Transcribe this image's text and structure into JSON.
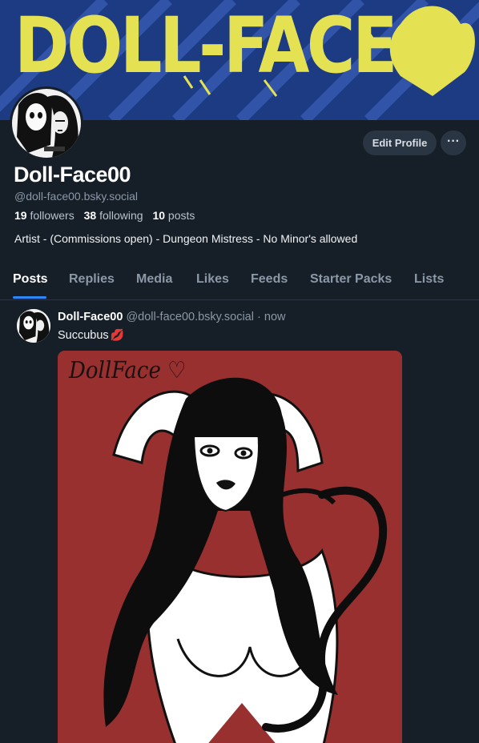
{
  "banner": {
    "text": "DOLL-FACE"
  },
  "profile": {
    "display_name": "Doll-Face00",
    "handle": "@doll-face00.bsky.social",
    "followers_count": "19",
    "followers_label": "followers",
    "following_count": "38",
    "following_label": "following",
    "posts_count": "10",
    "posts_label": "posts",
    "bio": "Artist - (Commissions open) - Dungeon Mistress - No Minor's allowed"
  },
  "actions": {
    "edit_profile": "Edit Profile",
    "more": "···"
  },
  "tabs": [
    {
      "label": "Posts",
      "active": true
    },
    {
      "label": "Replies"
    },
    {
      "label": "Media"
    },
    {
      "label": "Likes"
    },
    {
      "label": "Feeds"
    },
    {
      "label": "Starter Packs"
    },
    {
      "label": "Lists"
    }
  ],
  "post": {
    "author_name": "Doll-Face00",
    "author_handle": "@doll-face00.bsky.social",
    "separator": "·",
    "time": "now",
    "text": "Succubus",
    "emoji": "💋",
    "image_signature": "DollFace"
  },
  "colors": {
    "background": "#161e27",
    "banner_blue": "#1e3f8a",
    "banner_yellow": "#e4e253",
    "accent": "#2f86f6",
    "art_red": "#993030"
  }
}
